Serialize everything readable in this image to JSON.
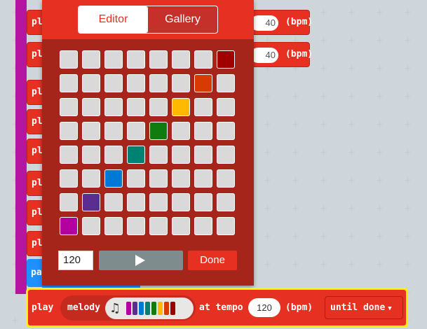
{
  "background_stack": {
    "blocks": [
      {
        "label": "pl",
        "tempo": "40",
        "bpm": "(bpm)"
      },
      {
        "label": "pl",
        "tempo": "40",
        "bpm": "(bpm)"
      },
      {
        "label": "pl"
      },
      {
        "label": "pl"
      },
      {
        "label": "pl"
      },
      {
        "label": "pl"
      },
      {
        "label": "pl"
      },
      {
        "label": "pl"
      }
    ],
    "pause_label": "pa"
  },
  "popup": {
    "tabs": [
      {
        "label": "Editor",
        "active": true
      },
      {
        "label": "Gallery",
        "active": false
      }
    ],
    "grid": {
      "rows": 8,
      "cols": 8,
      "active_notes": [
        {
          "col": 7,
          "row": 0,
          "color": "#a00000"
        },
        {
          "col": 6,
          "row": 1,
          "color": "#d83b01"
        },
        {
          "col": 5,
          "row": 2,
          "color": "#ffb900"
        },
        {
          "col": 4,
          "row": 3,
          "color": "#107c10"
        },
        {
          "col": 3,
          "row": 4,
          "color": "#008272"
        },
        {
          "col": 2,
          "row": 5,
          "color": "#0078d7"
        },
        {
          "col": 1,
          "row": 6,
          "color": "#5c2d91"
        },
        {
          "col": 0,
          "row": 7,
          "color": "#b4009e"
        }
      ]
    },
    "tempo_value": "120",
    "play_icon": "play-icon",
    "done_label": "Done"
  },
  "play_block": {
    "play_label": "play",
    "melody_label": "melody",
    "note_icon": "music-note-icon",
    "melody_preview_colors": [
      "#b4009e",
      "#5c2d91",
      "#0078d7",
      "#008272",
      "#107c10",
      "#ffb900",
      "#d83b01",
      "#a00000"
    ],
    "at_tempo_label": "at tempo",
    "tempo_value": "120",
    "bpm_label": "(bpm)",
    "until_label": "until done",
    "chevron_icon": "chevron-down-icon"
  },
  "colors": {
    "block_red": "#e63022",
    "popup_dark": "#a5251b",
    "selection_yellow": "#fff200",
    "stack_purple": "#b5159f",
    "pause_blue": "#1e90ff"
  }
}
